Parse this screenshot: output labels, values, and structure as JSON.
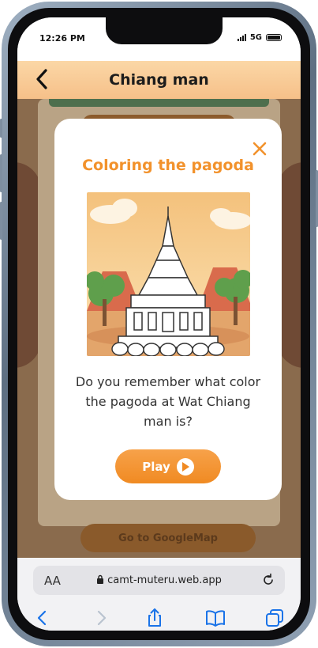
{
  "status": {
    "time": "12:26 PM",
    "network": "5G"
  },
  "header": {
    "title": "Chiang man"
  },
  "background": {
    "map_button_label": "Go to GoogleMap"
  },
  "modal": {
    "title": "Coloring the pagoda",
    "question": "Do you remember what color the pagoda at Wat Chiang man is?",
    "play_label": "Play"
  },
  "browser": {
    "aa_label": "AA",
    "url": "camt-muteru.web.app"
  },
  "icons": {
    "back": "chevron-left-icon",
    "close": "close-icon",
    "play": "play-circle-icon",
    "lock": "lock-icon",
    "reload": "reload-icon",
    "nav_back": "browser-back-icon",
    "nav_forward": "browser-forward-icon",
    "share": "share-icon",
    "bookmarks": "book-icon",
    "tabs": "tabs-icon"
  },
  "colors": {
    "accent": "#f2922c",
    "header": "#f6c089",
    "link_blue": "#1a73e8"
  }
}
